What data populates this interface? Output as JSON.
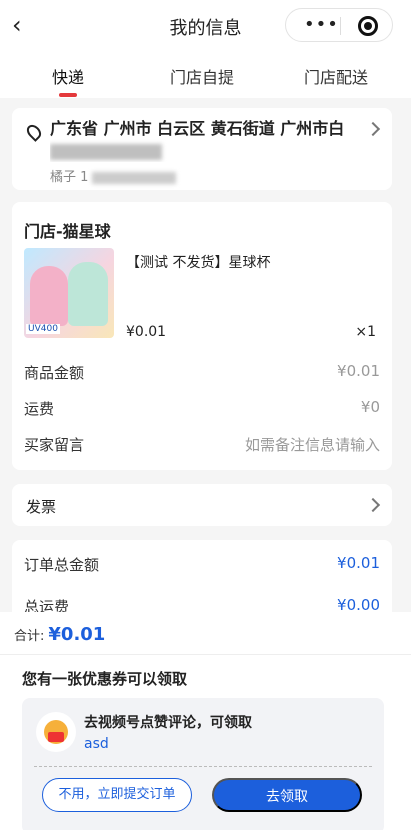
{
  "header": {
    "title": "我的信息",
    "back_icon": "chevron-left-icon",
    "more_icon": "more-dots-icon",
    "close_icon": "target-icon"
  },
  "tabs": [
    {
      "label": "快递",
      "active": true
    },
    {
      "label": "门店自提",
      "active": false
    },
    {
      "label": "门店配送",
      "active": false
    }
  ],
  "address": {
    "line": "广东省 广州市 白云区 黄石街道 广州市白",
    "name": "橘子 1"
  },
  "order": {
    "shop_name": "门店-猫星球",
    "product": {
      "name": "【测试 不发货】星球杯",
      "price": "¥0.01",
      "qty": "×1",
      "badge": "UV400"
    },
    "rows": [
      {
        "label": "商品金额",
        "value": "¥0.01"
      },
      {
        "label": "运费",
        "value": "¥0"
      },
      {
        "label": "买家留言",
        "value": "如需备注信息请输入"
      }
    ]
  },
  "invoice": {
    "label": "发票"
  },
  "totals": [
    {
      "label": "订单总金额",
      "value": "¥0.01"
    },
    {
      "label": "总运费",
      "value": "¥0.00"
    }
  ],
  "footer": {
    "sum_label": "合计:",
    "sum_value": "¥0.01"
  },
  "coupon": {
    "title": "您有一张优惠券可以领取",
    "line1": "去视频号点赞评论，可领取",
    "line2": "asd",
    "btn_secondary": "不用，立即提交订单",
    "btn_primary": "去领取"
  },
  "colors": {
    "accent": "#1c5fdc",
    "tab_underline": "#e4393c"
  }
}
